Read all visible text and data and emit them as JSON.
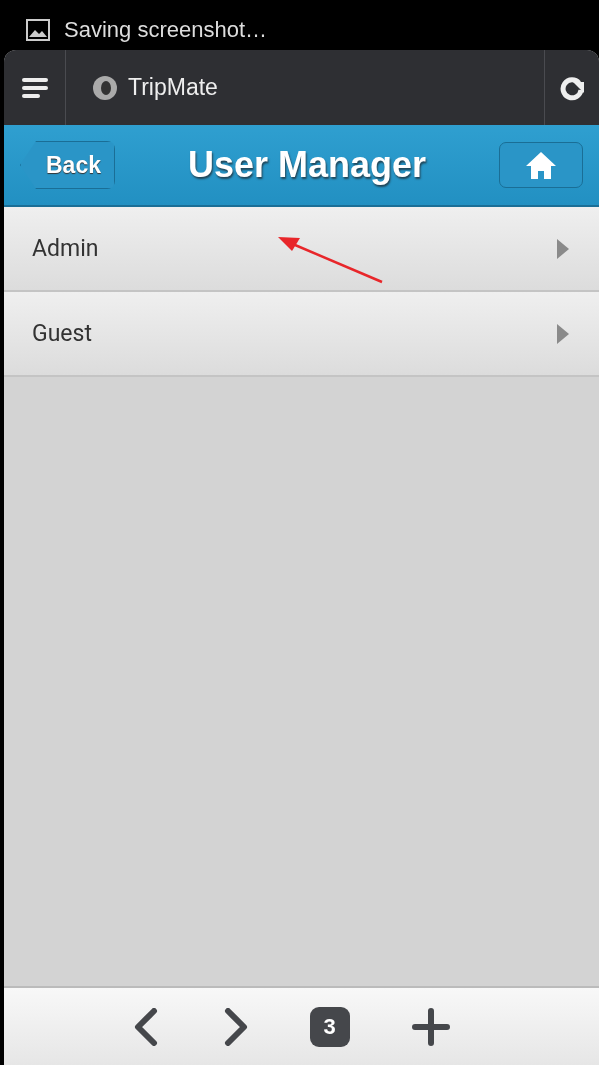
{
  "notification": {
    "text": "Saving screenshot…"
  },
  "browser_bar": {
    "title": "TripMate"
  },
  "header": {
    "back": "Back",
    "title": "User Manager"
  },
  "users": [
    {
      "name": "Admin"
    },
    {
      "name": "Guest"
    }
  ],
  "annotation": {
    "kind": "arrow"
  },
  "toolbar": {
    "tab_count": "3"
  }
}
